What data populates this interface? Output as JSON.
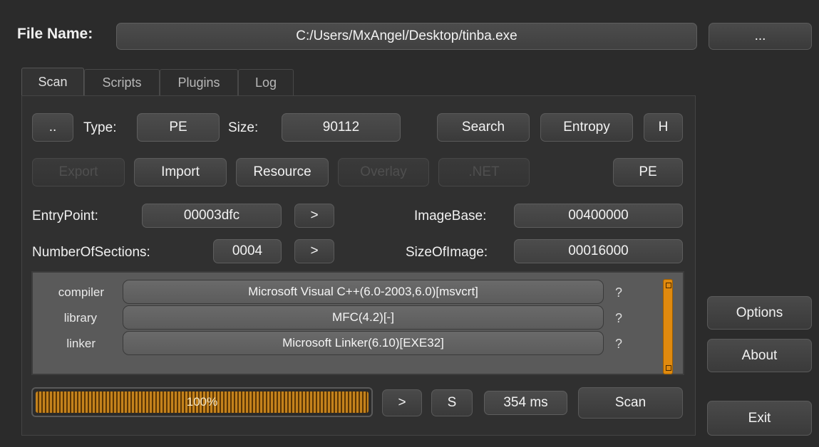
{
  "header": {
    "file_name_label": "File Name:",
    "file_path": "C:/Users/MxAngel/Desktop/tinba.exe",
    "browse_label": "..."
  },
  "tabs": [
    {
      "label": "Scan",
      "active": true
    },
    {
      "label": "Scripts",
      "active": false
    },
    {
      "label": "Plugins",
      "active": false
    },
    {
      "label": "Log",
      "active": false
    }
  ],
  "row1": {
    "dots_label": "..",
    "type_label": "Type:",
    "type_value": "PE",
    "size_label": "Size:",
    "size_value": "90112",
    "search_label": "Search",
    "entropy_label": "Entropy",
    "h_label": "H"
  },
  "row2": {
    "export_label": "Export",
    "import_label": "Import",
    "resource_label": "Resource",
    "overlay_label": "Overlay",
    "net_label": ".NET",
    "pe_label": "PE"
  },
  "pe_info": {
    "entrypoint_label": "EntryPoint:",
    "entrypoint_value": "00003dfc",
    "imagebase_label": "ImageBase:",
    "imagebase_value": "00400000",
    "numsections_label": "NumberOfSections:",
    "numsections_value": "0004",
    "sizeofimage_label": "SizeOfImage:",
    "sizeofimage_value": "00016000",
    "go_label": ">"
  },
  "results": [
    {
      "type": "compiler",
      "value": "Microsoft Visual C++(6.0-2003,6.0)[msvcrt]",
      "info": "?"
    },
    {
      "type": "library",
      "value": "MFC(4.2)[-]",
      "info": "?"
    },
    {
      "type": "linker",
      "value": "Microsoft Linker(6.10)[EXE32]",
      "info": "?"
    }
  ],
  "bottom": {
    "progress_percent": 100,
    "progress_text": "100%",
    "arrow_label": ">",
    "s_label": "S",
    "time_value": "354 ms",
    "scan_label": "Scan"
  },
  "side": {
    "options_label": "Options",
    "about_label": "About",
    "exit_label": "Exit"
  },
  "colors": {
    "background": "#2b2b2b",
    "accent": "#e08a0e"
  }
}
